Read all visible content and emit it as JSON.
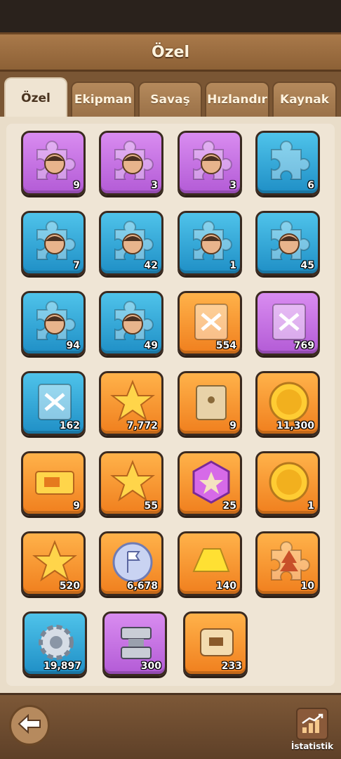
{
  "header": {
    "title": "Özel"
  },
  "tabs": [
    {
      "label": "Özel",
      "active": true
    },
    {
      "label": "Ekipman",
      "active": false
    },
    {
      "label": "Savaş",
      "active": false
    },
    {
      "label": "Hızlandır",
      "active": false
    },
    {
      "label": "Kaynak",
      "active": false
    }
  ],
  "items": [
    {
      "icon": "hero-puzzle-piece-icon",
      "color": "purple",
      "count": "9"
    },
    {
      "icon": "hero-puzzle-piece-icon",
      "color": "purple",
      "count": "3"
    },
    {
      "icon": "hero-puzzle-piece-icon",
      "color": "purple",
      "count": "3"
    },
    {
      "icon": "puzzle-piece-icon",
      "color": "blue",
      "count": "6"
    },
    {
      "icon": "hero-puzzle-piece-icon",
      "color": "blue",
      "count": "7"
    },
    {
      "icon": "hero-puzzle-piece-icon",
      "color": "blue",
      "count": "42"
    },
    {
      "icon": "hero-puzzle-piece-icon",
      "color": "blue",
      "count": "1"
    },
    {
      "icon": "hero-puzzle-piece-icon",
      "color": "blue",
      "count": "45"
    },
    {
      "icon": "hero-puzzle-piece-icon",
      "color": "blue",
      "count": "94"
    },
    {
      "icon": "hero-puzzle-piece-icon",
      "color": "blue",
      "count": "49"
    },
    {
      "icon": "skill-book-icon",
      "color": "orange",
      "count": "554"
    },
    {
      "icon": "skill-book-icon",
      "color": "purple",
      "count": "769"
    },
    {
      "icon": "skill-book-icon",
      "color": "blue",
      "count": "162"
    },
    {
      "icon": "star-medal-icon",
      "color": "orange",
      "count": "7,772"
    },
    {
      "icon": "envelope-icon",
      "color": "orange",
      "count": "9"
    },
    {
      "icon": "crossed-swords-coin-icon",
      "color": "orange",
      "count": "11,300"
    },
    {
      "icon": "truck-ticket-icon",
      "color": "orange",
      "count": "9"
    },
    {
      "icon": "star-ribbon-medal-icon",
      "color": "orange",
      "count": "55"
    },
    {
      "icon": "hexagon-badge-icon",
      "color": "orange",
      "count": "25"
    },
    {
      "icon": "clover-coin-icon",
      "color": "orange",
      "count": "1"
    },
    {
      "icon": "star-rosette-icon",
      "color": "orange",
      "count": "520"
    },
    {
      "icon": "flag-coin-icon",
      "color": "orange",
      "count": "6,678"
    },
    {
      "icon": "gold-ingot-icon",
      "color": "orange",
      "count": "140"
    },
    {
      "icon": "tree-puzzle-piece-icon",
      "color": "orange",
      "count": "10"
    },
    {
      "icon": "gear-icon",
      "color": "blue",
      "count": "19,897"
    },
    {
      "icon": "anvil-icon",
      "color": "purple",
      "count": "300"
    },
    {
      "icon": "scroll-icon",
      "color": "orange",
      "count": "233"
    }
  ],
  "footer": {
    "back_icon": "arrow-left-icon",
    "stats_icon": "bar-chart-icon",
    "stats_label": "İstatistik"
  }
}
